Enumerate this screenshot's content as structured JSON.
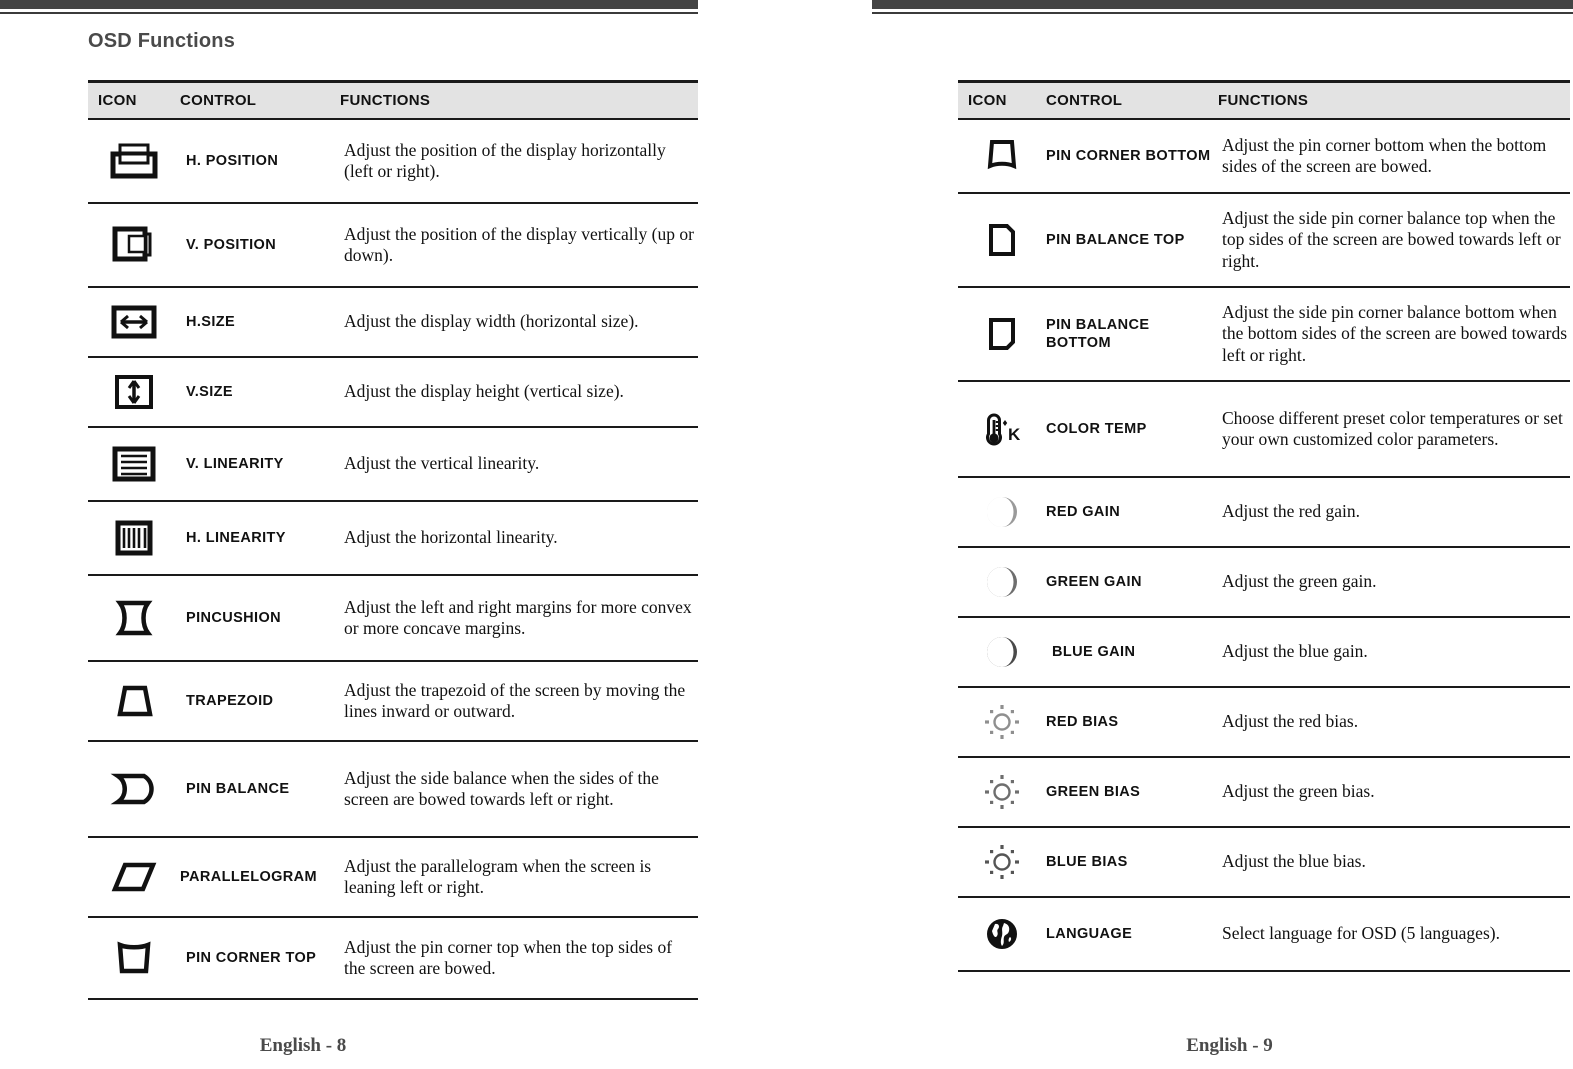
{
  "document": {
    "title": "OSD Functions"
  },
  "table_headers": {
    "icon": "ICON",
    "control": "CONTROL",
    "functions": "FUNCTIONS"
  },
  "pages": [
    {
      "footer": "English - 8",
      "title": "OSD Functions",
      "rows": [
        {
          "icon": "h-position-icon",
          "control": "H. POSITION",
          "function": "Adjust the position of the display horizontally (left or right)."
        },
        {
          "icon": "v-position-icon",
          "control": "V. POSITION",
          "function": "Adjust the position of the display vertically (up  or down)."
        },
        {
          "icon": "h-size-icon",
          "control": "H.SIZE",
          "function": "Adjust the display width (horizontal size)."
        },
        {
          "icon": "v-size-icon",
          "control": "V.SIZE",
          "function": "Adjust the display height (vertical size)."
        },
        {
          "icon": "v-linearity-icon",
          "control": "V. LINEARITY",
          "function": "Adjust the vertical linearity."
        },
        {
          "icon": "h-linearity-icon",
          "control": "H. LINEARITY",
          "function": "Adjust the horizontal linearity."
        },
        {
          "icon": "pincushion-icon",
          "control": "PINCUSHION",
          "function": "Adjust the left and right margins for more convex or more concave margins."
        },
        {
          "icon": "trapezoid-icon",
          "control": "TRAPEZOID",
          "function": "Adjust the trapezoid of the screen by moving the lines inward or outward."
        },
        {
          "icon": "pin-balance-icon",
          "control": "PIN BALANCE",
          "function": "Adjust the side balance when the sides of the screen are bowed towards left or right."
        },
        {
          "icon": "parallelogram-icon",
          "control": "PARALLELOGRAM",
          "function": "Adjust the parallelogram when the screen is leaning left or right."
        },
        {
          "icon": "pin-corner-top-icon",
          "control": "PIN CORNER TOP",
          "function": "Adjust the pin corner top when the top sides of the screen are bowed."
        }
      ]
    },
    {
      "footer": "English - 9",
      "rows": [
        {
          "icon": "pin-corner-bottom-icon",
          "control": "PIN CORNER BOTTOM",
          "function": "Adjust the pin corner bottom when the bottom sides of the screen are bowed."
        },
        {
          "icon": "pin-balance-top-icon",
          "control": "PIN BALANCE TOP",
          "function": "Adjust the side pin corner balance top when the top sides of the screen are bowed towards left or right."
        },
        {
          "icon": "pin-balance-bottom-icon",
          "control": "PIN BALANCE BOTTOM",
          "function": "Adjust the side pin corner balance bottom when the bottom sides of the screen are bowed towards left or right."
        },
        {
          "icon": "color-temp-icon",
          "control": "COLOR TEMP",
          "function": "Choose different preset color temperatures or set your own customized color parameters."
        },
        {
          "icon": "red-gain-icon",
          "control": "RED GAIN",
          "function": "Adjust the red gain."
        },
        {
          "icon": "green-gain-icon",
          "control": "GREEN GAIN",
          "function": "Adjust the green gain."
        },
        {
          "icon": "blue-gain-icon",
          "control": "BLUE GAIN",
          "function": "Adjust the blue gain."
        },
        {
          "icon": "red-bias-icon",
          "control": "RED BIAS",
          "function": "Adjust the red bias."
        },
        {
          "icon": "green-bias-icon",
          "control": "GREEN BIAS",
          "function": "Adjust the green bias."
        },
        {
          "icon": "blue-bias-icon",
          "control": "BLUE BIAS",
          "function": "Adjust the blue bias."
        },
        {
          "icon": "language-icon",
          "control": "LANGUAGE",
          "function": "Select language for OSD (5 languages)."
        }
      ]
    }
  ],
  "colors": {
    "rule": "#444444",
    "header_bg": "#e3e3e3",
    "text": "#111111",
    "title": "#4a4a4a",
    "gain_red_fill": "#9a9a9a",
    "gain_green_fill": "#6e6e6e",
    "gain_blue_fill": "#4a4a4a"
  }
}
